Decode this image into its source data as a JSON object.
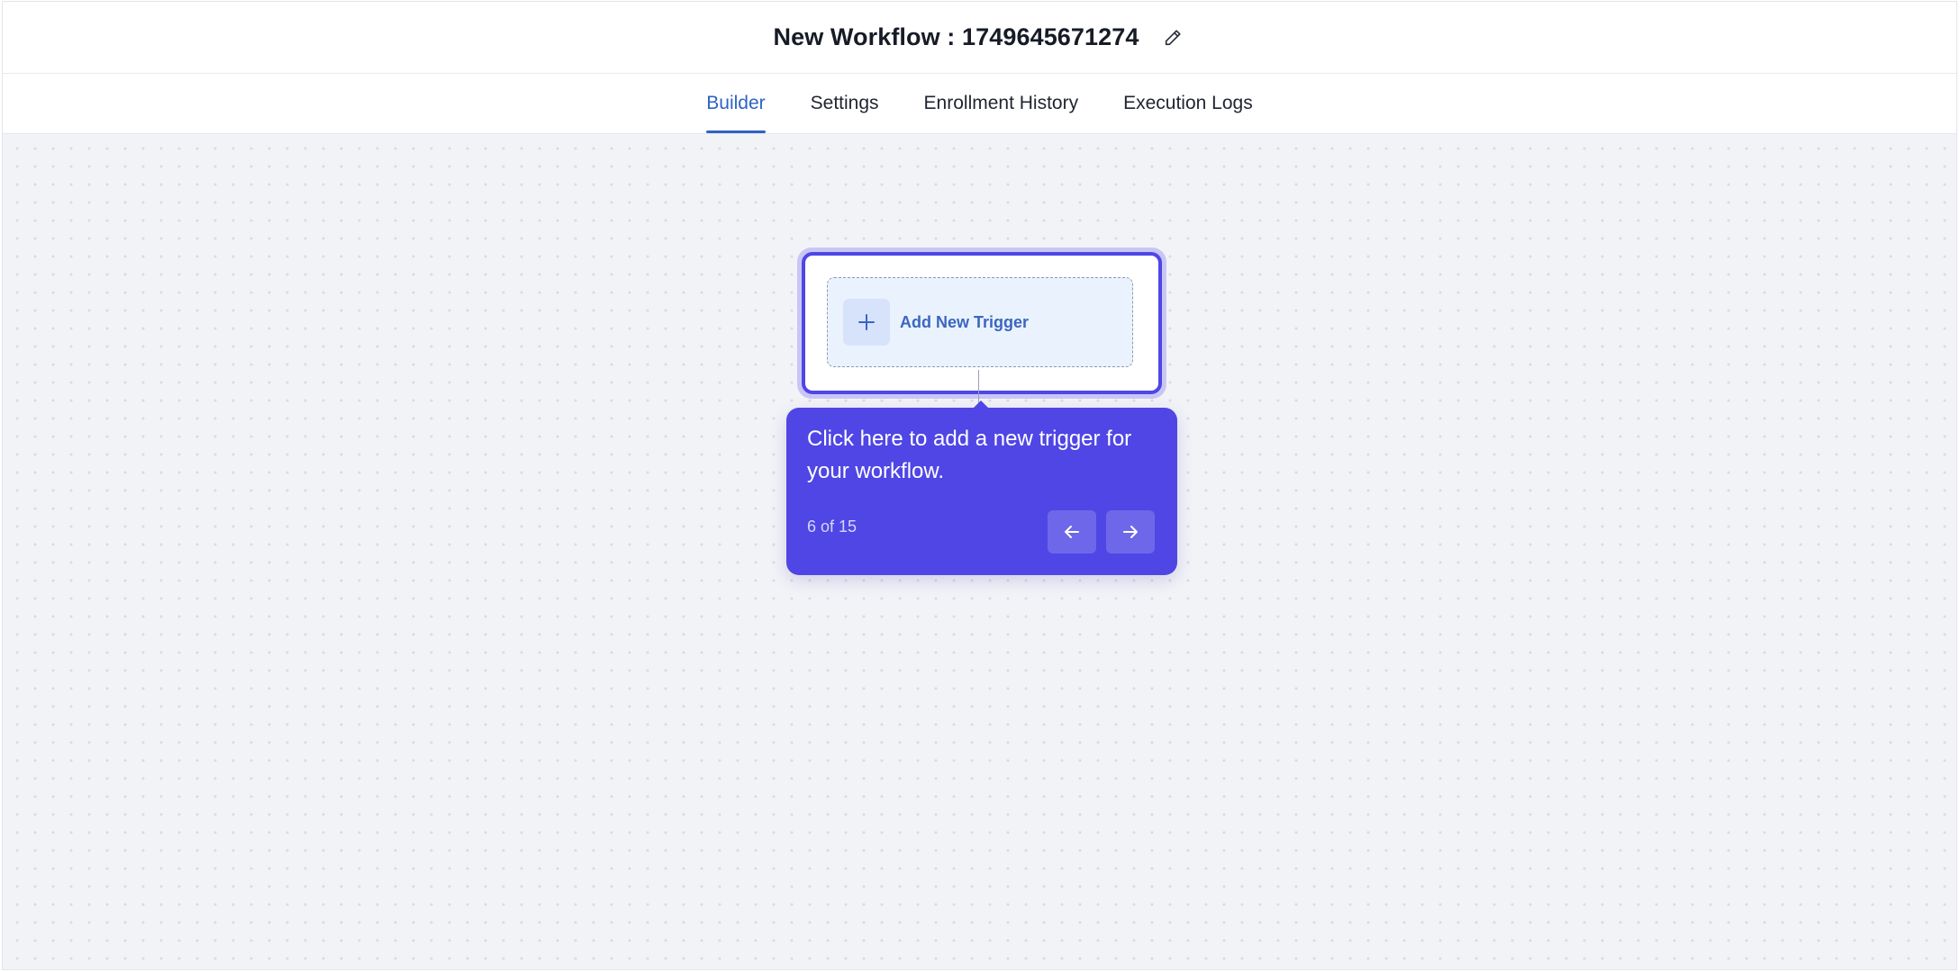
{
  "header": {
    "title": "New Workflow : 1749645671274",
    "edit_icon": "pencil-icon"
  },
  "tabs": [
    {
      "label": "Builder",
      "active": true
    },
    {
      "label": "Settings",
      "active": false
    },
    {
      "label": "Enrollment History",
      "active": false
    },
    {
      "label": "Execution Logs",
      "active": false
    }
  ],
  "canvas": {
    "trigger": {
      "label": "Add New Trigger",
      "icon": "plus-icon"
    },
    "tooltip": {
      "message": "Click here to add a new trigger for your workflow.",
      "counter": "6 of 15",
      "current_step": 6,
      "total_steps": 15,
      "prev_icon": "arrow-left-icon",
      "next_icon": "arrow-right-icon"
    }
  },
  "colors": {
    "accent": "#4f46e5",
    "tab_active": "#2f63c4",
    "canvas_bg": "#f2f3f7",
    "trigger_bg": "#eaf2fd"
  }
}
